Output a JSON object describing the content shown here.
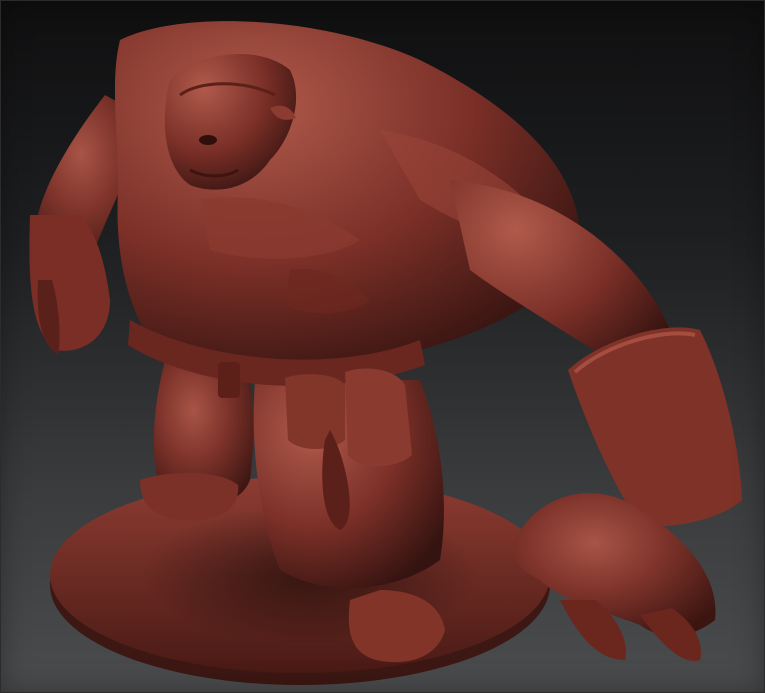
{
  "viewport": {
    "background_top": "#0f0f10",
    "background_bottom": "#4b4c4e"
  },
  "model": {
    "material_color": "#7a2f27",
    "highlight_color": "#a14a3e",
    "shadow_color": "#3a1410",
    "subject": "sculpted-brute-character-on-round-base"
  }
}
